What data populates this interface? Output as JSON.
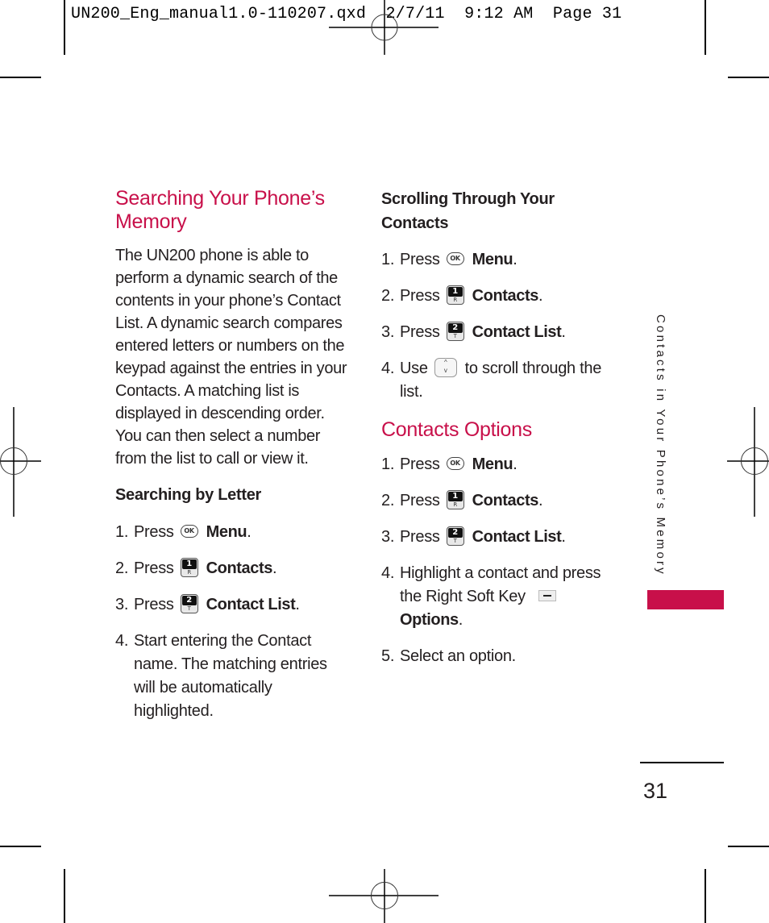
{
  "slug": {
    "text": "UN200_Eng_manual1.0-110207.qxd  2/7/11  9:12 AM  Page 31"
  },
  "left_column": {
    "heading": "Searching Your Phone's Memory",
    "heading_line1": "Searching Your Phone’s",
    "heading_line2": "Memory",
    "intro": "The UN200 phone is able to perform a dynamic search of the contents in your phone’s Contact List. A dynamic search compares entered letters or numbers on the keypad against the entries in your Contacts. A matching list is displayed in descending order. You can then select a number from the list to call or view it.",
    "subheading": "Searching by Letter",
    "steps": [
      {
        "num": "1.",
        "pre": "Press",
        "key": "ok-key",
        "key_label": "OK",
        "bold": "Menu",
        "post": "."
      },
      {
        "num": "2.",
        "pre": "Press",
        "key": "1-key",
        "key_top": "1",
        "key_bottom": "R",
        "bold": "Contacts",
        "post": "."
      },
      {
        "num": "3.",
        "pre": "Press",
        "key": "2-key",
        "key_top": "2",
        "key_bottom": "T",
        "bold": "Contact List",
        "post": "."
      },
      {
        "num": "4.",
        "text": "Start entering the Contact name. The matching entries will be automatically highlighted."
      }
    ]
  },
  "right_column": {
    "scroll_section": {
      "heading": "Scrolling Through Your Contacts",
      "steps": [
        {
          "num": "1.",
          "pre": "Press",
          "key": "ok-key",
          "key_label": "OK",
          "bold": "Menu",
          "post": "."
        },
        {
          "num": "2.",
          "pre": "Press",
          "key": "1-key",
          "key_top": "1",
          "key_bottom": "R",
          "bold": "Contacts",
          "post": "."
        },
        {
          "num": "3.",
          "pre": "Press",
          "key": "2-key",
          "key_top": "2",
          "key_bottom": "T",
          "bold": "Contact List",
          "post": "."
        },
        {
          "num": "4.",
          "pre": "Use",
          "key": "nav-key",
          "key_up": "^",
          "key_down": "v",
          "text": "to scroll through the list."
        }
      ]
    },
    "options_section": {
      "heading": "Contacts Options",
      "steps": [
        {
          "num": "1.",
          "pre": "Press",
          "key": "ok-key",
          "key_label": "OK",
          "bold": "Menu",
          "post": "."
        },
        {
          "num": "2.",
          "pre": "Press",
          "key": "1-key",
          "key_top": "1",
          "key_bottom": "R",
          "bold": "Contacts",
          "post": "."
        },
        {
          "num": "3.",
          "pre": "Press",
          "key": "2-key",
          "key_top": "2",
          "key_bottom": "T",
          "bold": "Contact List",
          "post": "."
        },
        {
          "num": "4.",
          "pre": "Highlight a contact and press the Right Soft Key",
          "key": "right-soft-key",
          "bold": "Options",
          "post": "."
        },
        {
          "num": "5.",
          "text": "Select an option."
        }
      ]
    }
  },
  "side_tab": {
    "label": "Contacts in Your Phone’s Memory",
    "color": "#c8104a"
  },
  "footer": {
    "page_number": "31"
  },
  "colors": {
    "accent": "#c8104a",
    "text": "#231f20"
  }
}
